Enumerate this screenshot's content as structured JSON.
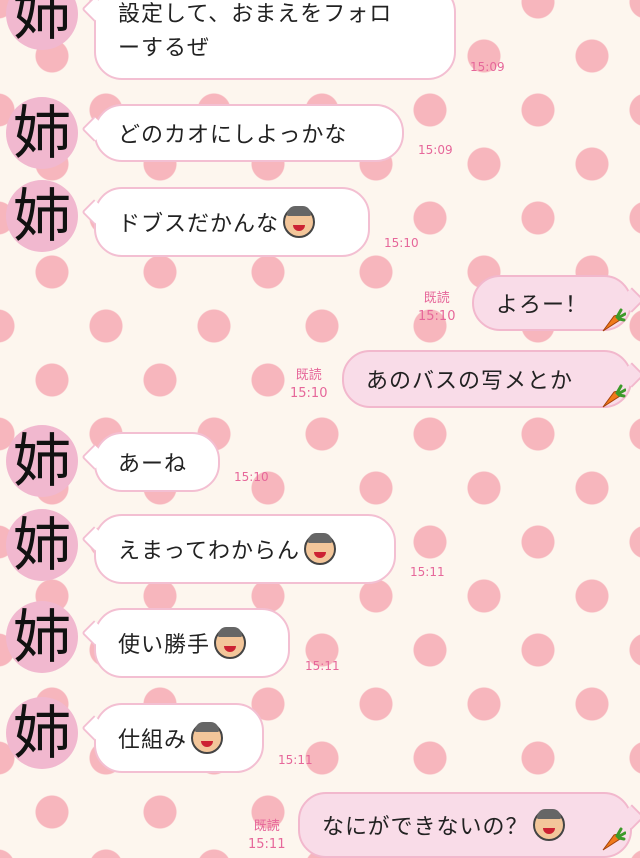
{
  "contact_avatar_char": "姉",
  "messages": [
    {
      "lines": [
        "設定して、おまえをフォロ",
        "ーするぜ"
      ],
      "time": "15:09"
    },
    {
      "text": "どのカオにしよっかな",
      "time": "15:09"
    },
    {
      "text": "ドブスだかんな",
      "time": "15:10"
    },
    {
      "text": "よろー！",
      "read": "既読",
      "time": "15:10"
    },
    {
      "text": "あのバスの写メとか",
      "read": "既読",
      "time": "15:10"
    },
    {
      "text": "あーね",
      "time": "15:10"
    },
    {
      "text": "えまってわからん",
      "time": "15:11"
    },
    {
      "text": "使い勝手",
      "time": "15:11"
    },
    {
      "text": "仕組み",
      "time": "15:11"
    },
    {
      "text": "なにができないの？",
      "read": "既読",
      "time": "15:11"
    }
  ],
  "icons": {
    "sticker_face": "old-man-face-icon",
    "carrot": "carrot-icon"
  }
}
